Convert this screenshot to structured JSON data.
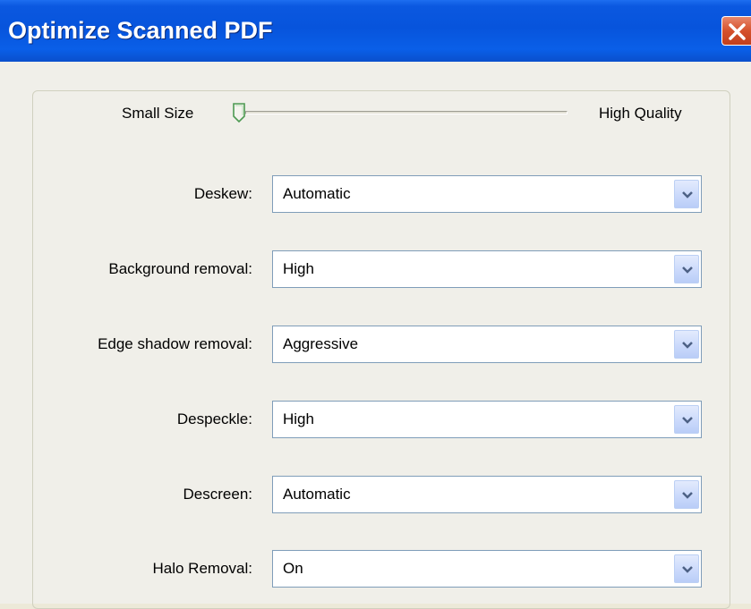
{
  "window": {
    "title": "Optimize Scanned PDF"
  },
  "slider": {
    "min_label": "Small Size",
    "max_label": "High Quality",
    "value_fraction": 0.0
  },
  "fields": {
    "deskew": {
      "label": "Deskew:",
      "value": "Automatic"
    },
    "background_removal": {
      "label": "Background removal:",
      "value": "High"
    },
    "edge_shadow_removal": {
      "label": "Edge shadow removal:",
      "value": "Aggressive"
    },
    "despeckle": {
      "label": "Despeckle:",
      "value": "High"
    },
    "descreen": {
      "label": "Descreen:",
      "value": "Automatic"
    },
    "halo_removal": {
      "label": "Halo Removal:",
      "value": "On"
    }
  },
  "icons": {
    "close": "close-icon",
    "dropdown": "chevron-down-icon",
    "slider_thumb": "slider-thumb"
  },
  "colors": {
    "titlebar": "#0754dc",
    "close_button": "#d5512c",
    "combo_border": "#7f9db9",
    "dialog_background": "#f0efe9"
  }
}
